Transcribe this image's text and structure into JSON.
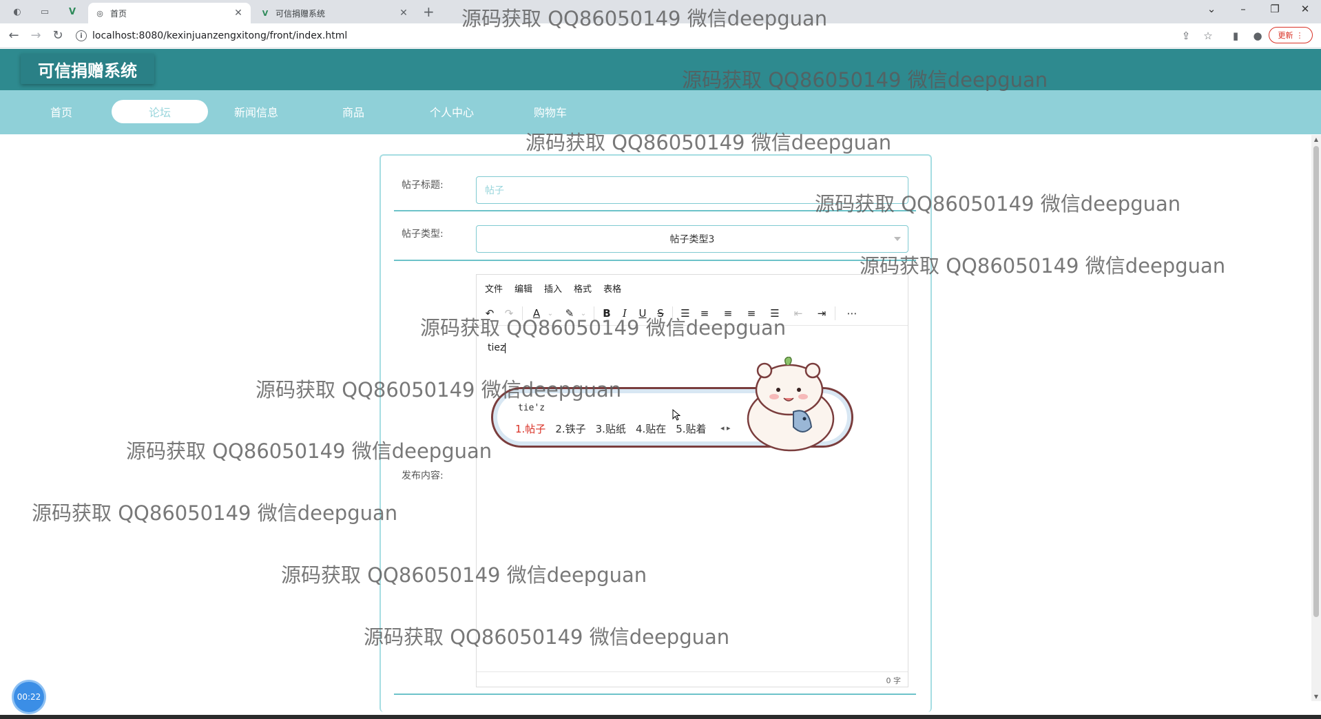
{
  "browser": {
    "tabs": [
      {
        "label": "首页",
        "active": true
      },
      {
        "label": "可信捐赠系统",
        "active": false
      }
    ],
    "new_tab": "+",
    "url": "localhost:8080/kexinjuanzengxitong/front/index.html",
    "update_button": "更新",
    "window_controls": {
      "minimize": "–",
      "restore": "❐",
      "close": "✕",
      "dropdown": "⌄"
    }
  },
  "site": {
    "title": "可信捐赠系统",
    "nav": [
      {
        "label": "首页",
        "active": false
      },
      {
        "label": "论坛",
        "active": true
      },
      {
        "label": "新闻信息",
        "active": false
      },
      {
        "label": "商品",
        "active": false
      },
      {
        "label": "个人中心",
        "active": false
      },
      {
        "label": "购物车",
        "active": false
      }
    ]
  },
  "form": {
    "title_label": "帖子标题:",
    "title_value": "帖子",
    "type_label": "帖子类型:",
    "type_value": "帖子类型3",
    "content_label": "发布内容:"
  },
  "editor": {
    "menu": [
      "文件",
      "编辑",
      "插入",
      "格式",
      "表格"
    ],
    "content_text": "tiez",
    "word_count": "0 字"
  },
  "ime": {
    "composition": "tie'z",
    "candidates": [
      "1.帖子",
      "2.铁子",
      "3.贴纸",
      "4.贴在",
      "5.贴着"
    ]
  },
  "timer": "00:22",
  "watermark_text": "源码获取 QQ86050149 微信deepguan",
  "colors": {
    "header": "#2e8a8f",
    "nav": "#8fd0d8",
    "accent": "#6cc2c9",
    "timer": "#3b8ee6",
    "candidate_highlight": "#d93025"
  }
}
